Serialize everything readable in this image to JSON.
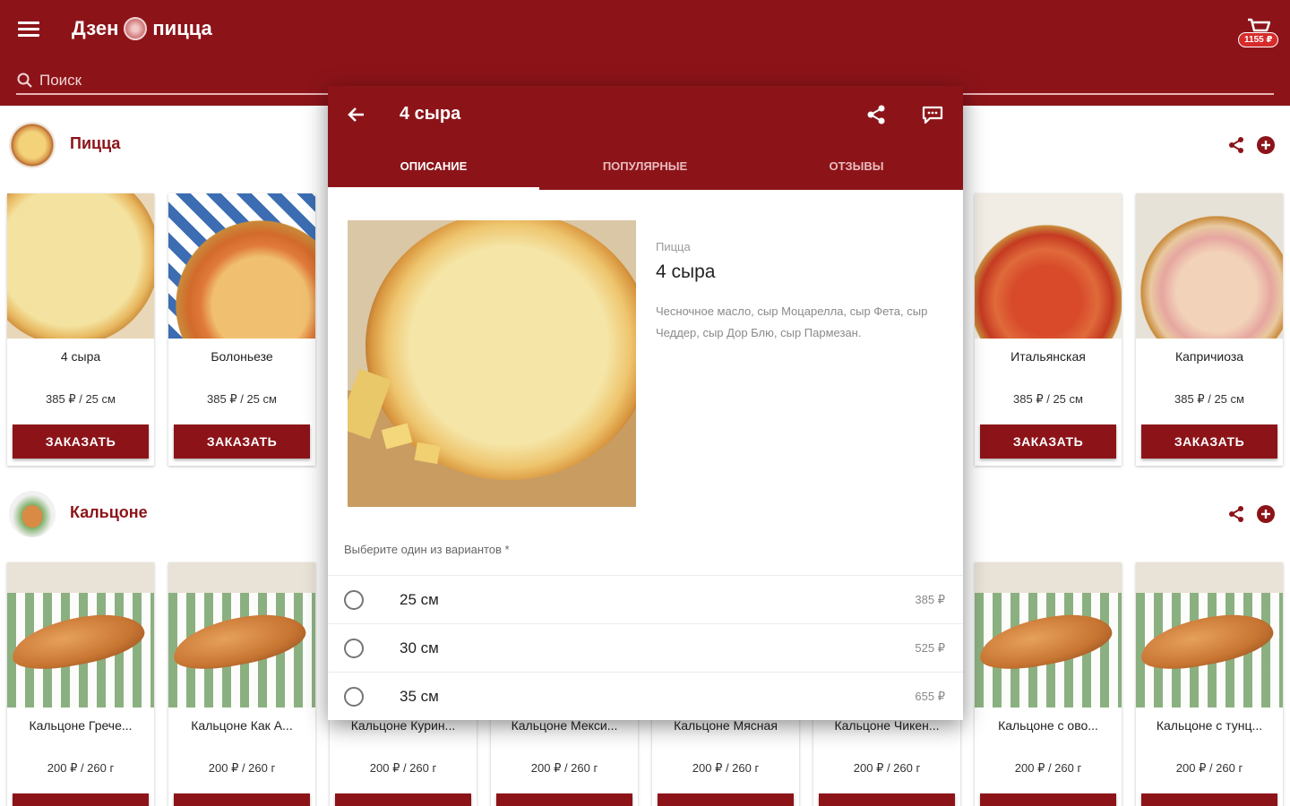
{
  "app": {
    "logo_left": "Дзен",
    "logo_right": "пицца",
    "cart_total": "1155 ₽",
    "search_placeholder": "Поиск"
  },
  "categories": [
    {
      "title": "Пицца",
      "products": [
        {
          "name": "4 сыра",
          "price": "385 ₽ / 25 см",
          "button": "ЗАКАЗАТЬ"
        },
        {
          "name": "Болоньезе",
          "price": "385 ₽ / 25 см",
          "button": "ЗАКАЗАТЬ"
        },
        {
          "name": "Итальянская",
          "price": "385 ₽ / 25 см",
          "button": "ЗАКАЗАТЬ"
        },
        {
          "name": "Капричиоза",
          "price": "385 ₽ / 25 см",
          "button": "ЗАКАЗАТЬ"
        }
      ]
    },
    {
      "title": "Кальцоне",
      "products": [
        {
          "name": "Кальцоне Грече...",
          "price": "200 ₽ / 260 г"
        },
        {
          "name": "Кальцоне Как А...",
          "price": "200 ₽ / 260 г"
        },
        {
          "name": "Кальцоне Курин...",
          "price": "200 ₽ / 260 г"
        },
        {
          "name": "Кальцоне Мекси...",
          "price": "200 ₽ / 260 г"
        },
        {
          "name": "Кальцоне Мясная",
          "price": "200 ₽ / 260 г"
        },
        {
          "name": "Кальцоне Чикен...",
          "price": "200 ₽ / 260 г"
        },
        {
          "name": "Кальцоне с ово...",
          "price": "200 ₽ / 260 г"
        },
        {
          "name": "Кальцоне с тунц...",
          "price": "200 ₽ / 260 г"
        }
      ]
    }
  ],
  "dialog": {
    "title": "4 сыра",
    "tabs": [
      "ОПИСАНИЕ",
      "ПОПУЛЯРНЫЕ",
      "ОТЗЫВЫ"
    ],
    "active_tab": 0,
    "category": "Пицца",
    "name": "4 сыра",
    "description": "Чесночное масло, сыр Моцарелла, сыр Фета, сыр Чеддер, сыр Дор Блю, сыр Пармезан.",
    "variants_hint": "Выберите один из вариантов *",
    "options": [
      {
        "label": "25 см",
        "price": "385 ₽"
      },
      {
        "label": "30 см",
        "price": "525 ₽"
      },
      {
        "label": "35 см",
        "price": "655 ₽"
      }
    ]
  },
  "colors": {
    "brand": "#8c1419",
    "badge": "#d72b2b"
  },
  "icons": [
    "menu-icon",
    "cart-icon",
    "search-icon",
    "share-icon",
    "add-circle-icon",
    "back-arrow-icon",
    "comment-icon"
  ]
}
